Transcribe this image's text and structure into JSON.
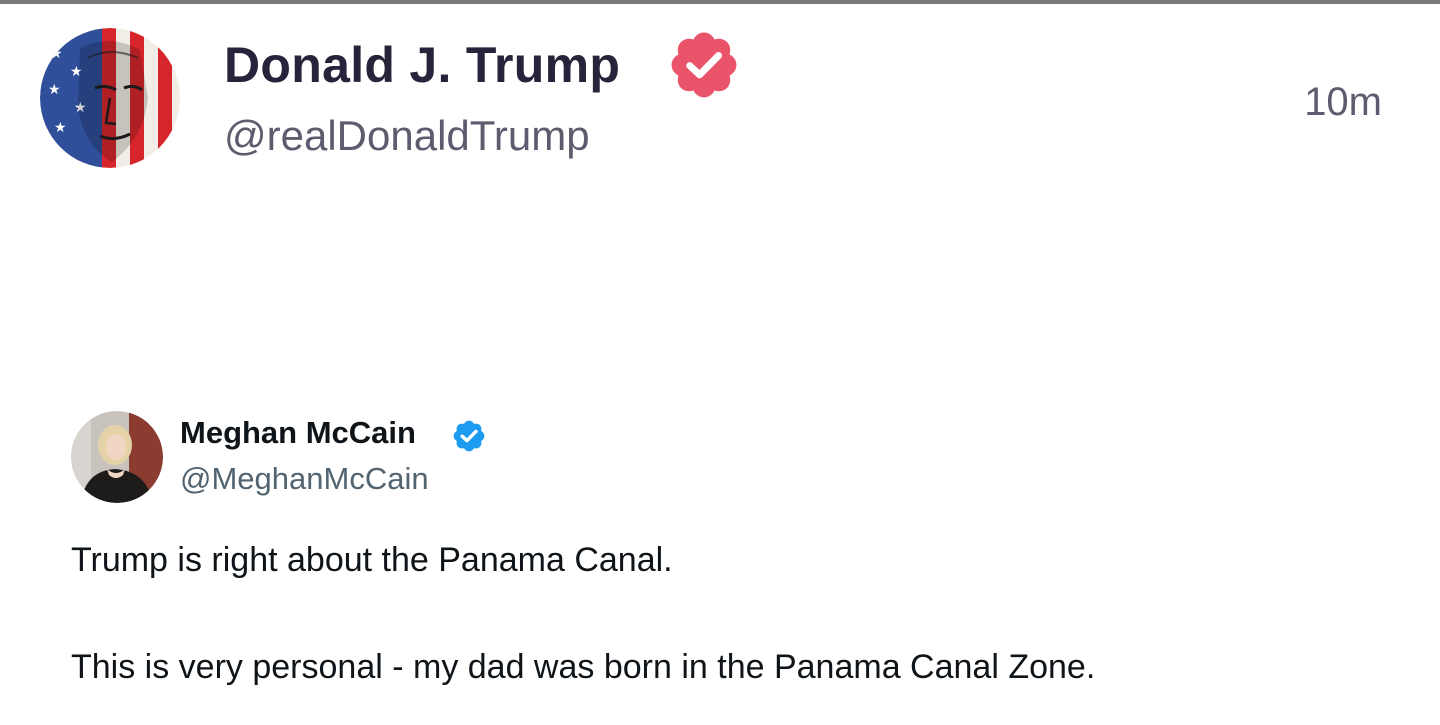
{
  "post": {
    "author_name": "Donald J. Trump",
    "author_handle": "@realDonaldTrump",
    "timestamp": "10m",
    "verified_badge_color": "#e9546b",
    "verified_badge_icon": "verified-scallop-check-icon"
  },
  "quoted_post": {
    "author_name": "Meghan McCain",
    "author_handle": "@MeghanMcCain",
    "verified_badge_color": "#1d9bf0",
    "verified_badge_icon": "verified-scallop-check-icon",
    "lines": [
      "Trump is right about the Panama Canal.",
      "This is very personal - my dad was born in the Panama Canal Zone."
    ]
  }
}
